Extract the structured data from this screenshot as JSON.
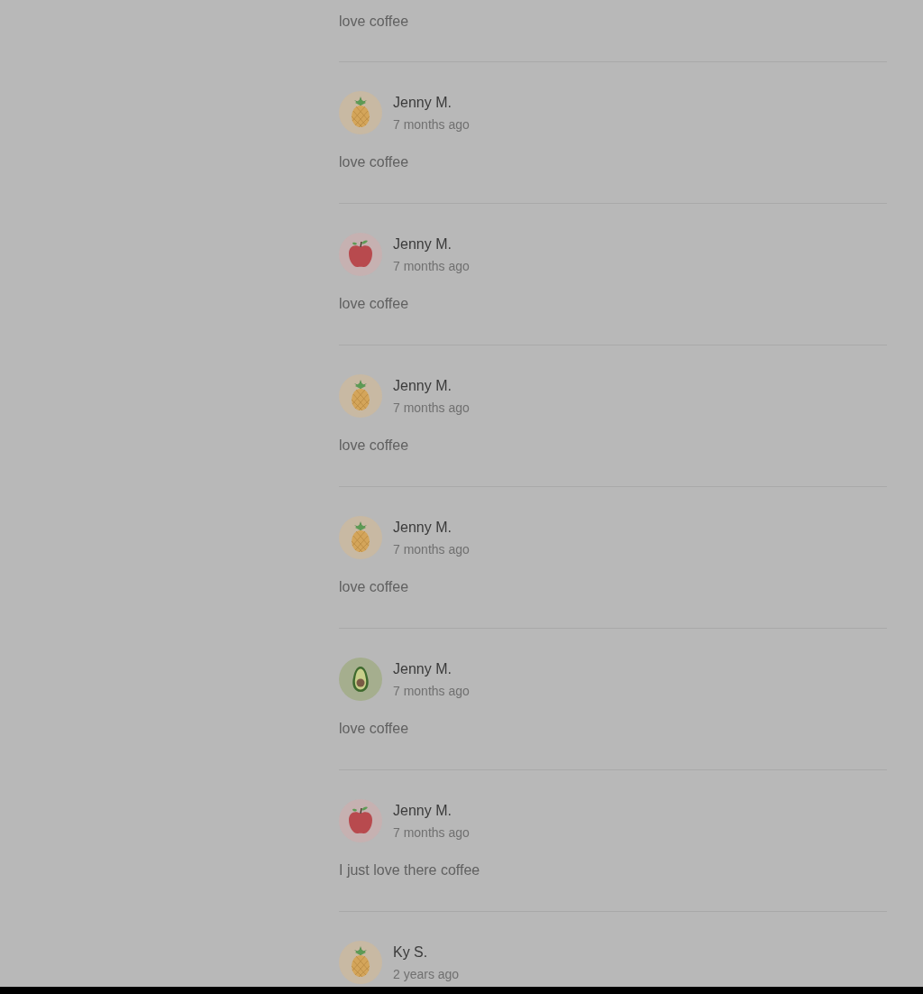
{
  "reviews": [
    {
      "text": "love coffee"
    },
    {
      "avatar": {
        "kind": "pineapple"
      },
      "name": "Jenny M.",
      "time": "7 months ago",
      "text": "love coffee"
    },
    {
      "avatar": {
        "kind": "apple"
      },
      "name": "Jenny M.",
      "time": "7 months ago",
      "text": "love coffee"
    },
    {
      "avatar": {
        "kind": "pineapple"
      },
      "name": "Jenny M.",
      "time": "7 months ago",
      "text": "love coffee"
    },
    {
      "avatar": {
        "kind": "pineapple"
      },
      "name": "Jenny M.",
      "time": "7 months ago",
      "text": "love coffee"
    },
    {
      "avatar": {
        "kind": "avocado"
      },
      "name": "Jenny M.",
      "time": "7 months ago",
      "text": "love coffee"
    },
    {
      "avatar": {
        "kind": "apple"
      },
      "name": "Jenny M.",
      "time": "7 months ago",
      "text": "I just love there coffee"
    },
    {
      "avatar": {
        "kind": "pineapple"
      },
      "name": "Ky S.",
      "time": "2 years ago"
    }
  ]
}
